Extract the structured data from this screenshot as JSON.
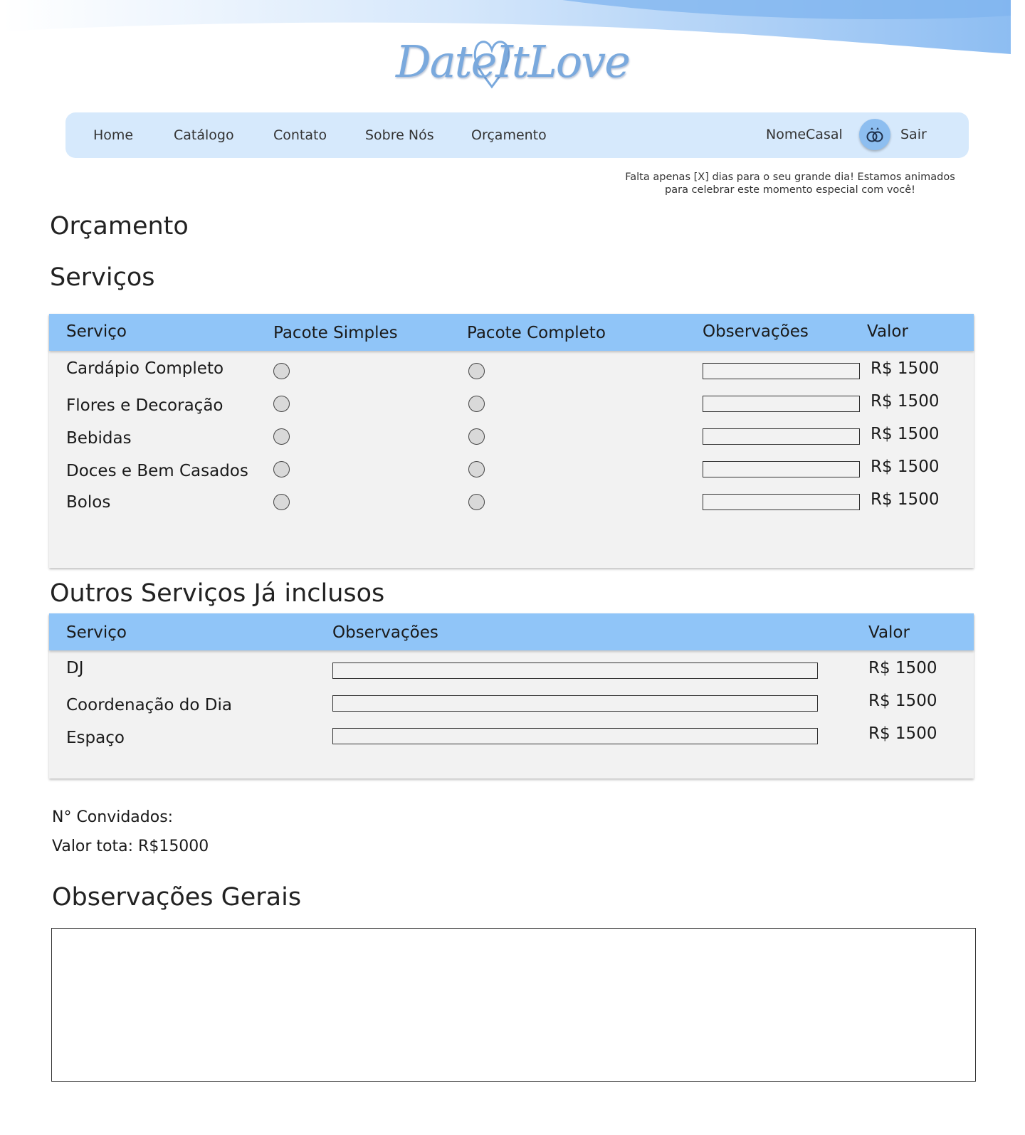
{
  "brand": {
    "logo_text": "DateItLove"
  },
  "nav": {
    "items": [
      "Home",
      "Catálogo",
      "Contato",
      "Sobre Nós",
      "Orçamento"
    ],
    "user_name": "NomeCasal",
    "logout": "Sair"
  },
  "countdown": {
    "line1": "Falta apenas [X] dias para o seu grande dia! Estamos animados",
    "line2": "para celebrar este momento especial com você!"
  },
  "page_title": "Orçamento",
  "services": {
    "title": "Serviços",
    "headers": {
      "service": "Serviço",
      "simple": "Pacote Simples",
      "complete": "Pacote Completo",
      "notes": "Observações",
      "value": "Valor"
    },
    "rows": [
      {
        "name": "Cardápio Completo",
        "value": "R$ 1500"
      },
      {
        "name": "Flores e Decoração",
        "value": "R$ 1500"
      },
      {
        "name": "Bebidas",
        "value": "R$ 1500"
      },
      {
        "name": "Doces e Bem Casados",
        "value": "R$ 1500"
      },
      {
        "name": "Bolos",
        "value": "R$ 1500"
      }
    ]
  },
  "other_services": {
    "title": "Outros Serviços Já inclusos",
    "headers": {
      "service": "Serviço",
      "notes": "Observações",
      "value": "Valor"
    },
    "rows": [
      {
        "name": "DJ",
        "value": "R$ 1500"
      },
      {
        "name": "Coordenação do Dia",
        "value": "R$ 1500"
      },
      {
        "name": "Espaço",
        "value": "R$ 1500"
      }
    ]
  },
  "summary": {
    "guests_label": "N° Convidados:",
    "total_label": "Valor tota: R$15000"
  },
  "general_notes": {
    "title": "Observações Gerais"
  },
  "colors": {
    "nav_bg": "#d6e9fc",
    "table_header": "#90c5f8",
    "accent": "#7aa9dd"
  }
}
